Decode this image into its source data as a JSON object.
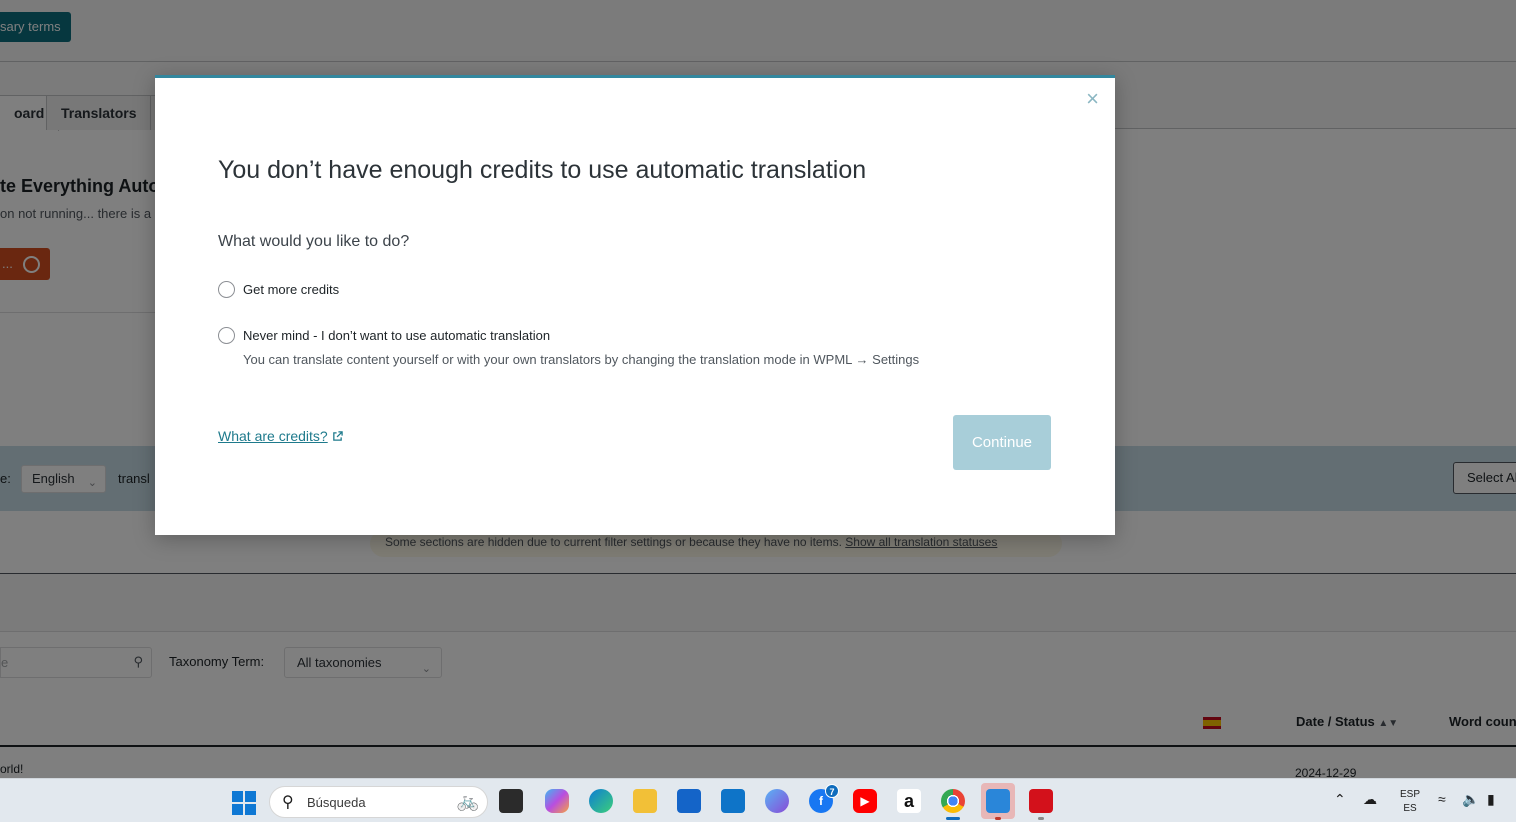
{
  "background": {
    "glossary_button": "sary terms",
    "tabs": [
      "oard",
      "Translators"
    ],
    "translate_all_title": "te Everything Auto",
    "translate_all_subtitle": "on not running... there is a",
    "translate_all_button": "...",
    "filter": {
      "label_fragment": "e:",
      "language_value": "English",
      "translation_fragment": "transl",
      "select_all": "Select All"
    },
    "notice": {
      "text": "Some sections are hidden due to current filter settings or because they have no items.",
      "link": "Show all translation statuses"
    },
    "search_placeholder": "e",
    "taxonomy_label": "Taxonomy Term:",
    "taxonomy_value": "All taxonomies",
    "columns": {
      "date_status": "Date / Status",
      "word_count": "Word coun"
    },
    "row": {
      "title": "orld!",
      "date": "2024-12-29"
    }
  },
  "modal": {
    "close_glyph": "×",
    "title": "You don’t have enough credits to use automatic translation",
    "question": "What would you like to do?",
    "options": [
      {
        "label": "Get more credits"
      },
      {
        "label": "Never mind - I don’t want to use automatic translation",
        "description": "You can translate content yourself or with your own translators by changing the translation mode in WPML → Settings"
      }
    ],
    "credits_link": "What are credits?",
    "continue_button": "Continue"
  },
  "taskbar": {
    "search_text": "Búsqueda",
    "facebook_badge": "7",
    "lang_line1": "ESP",
    "lang_line2": "ES"
  },
  "colors": {
    "accent": "#33879e",
    "continue_disabled": "#a8ced9",
    "link": "#1e7a8c",
    "glossary_button": "#0c6e7e",
    "translate_all_button": "#d54e21"
  }
}
